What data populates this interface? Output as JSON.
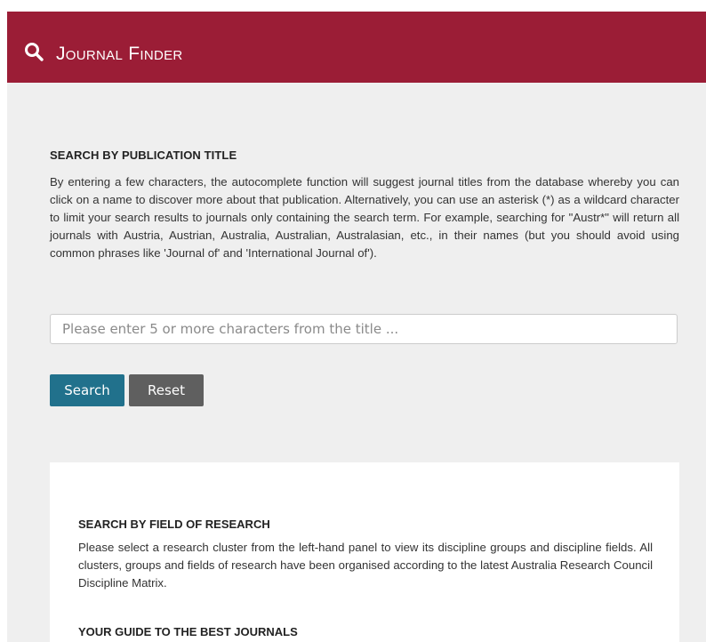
{
  "header": {
    "title": "Journal Finder",
    "icon": "search-icon",
    "background_color": "#9b1d36"
  },
  "publication_search": {
    "heading": "SEARCH BY PUBLICATION TITLE",
    "description": "By entering a few characters, the autocomplete function will suggest journal titles from the database whereby you can click on a name to discover more about that publication. Alternatively, you can use an asterisk (*) as a wildcard character to limit your search results to journals only containing the search term. For example, searching for \"Austr*\" will return all journals with Austria, Austrian, Australia, Australian, Australasian, etc., in their names (but you should avoid using common phrases like 'Journal of' and 'International Journal of').",
    "input_value": "",
    "input_placeholder": "Please enter 5 or more characters from the title ...",
    "search_button": "Search",
    "reset_button": "Reset",
    "search_button_color": "#21718c",
    "reset_button_color": "#5f5f5f"
  },
  "field_search": {
    "heading": "SEARCH BY FIELD OF RESEARCH",
    "description": "Please select a research cluster from the left-hand panel to view its discipline groups and discipline fields. All clusters, groups and fields of research have been organised according to the latest Australia Research Council Discipline Matrix.",
    "guide_heading": "YOUR GUIDE TO THE BEST JOURNALS"
  }
}
